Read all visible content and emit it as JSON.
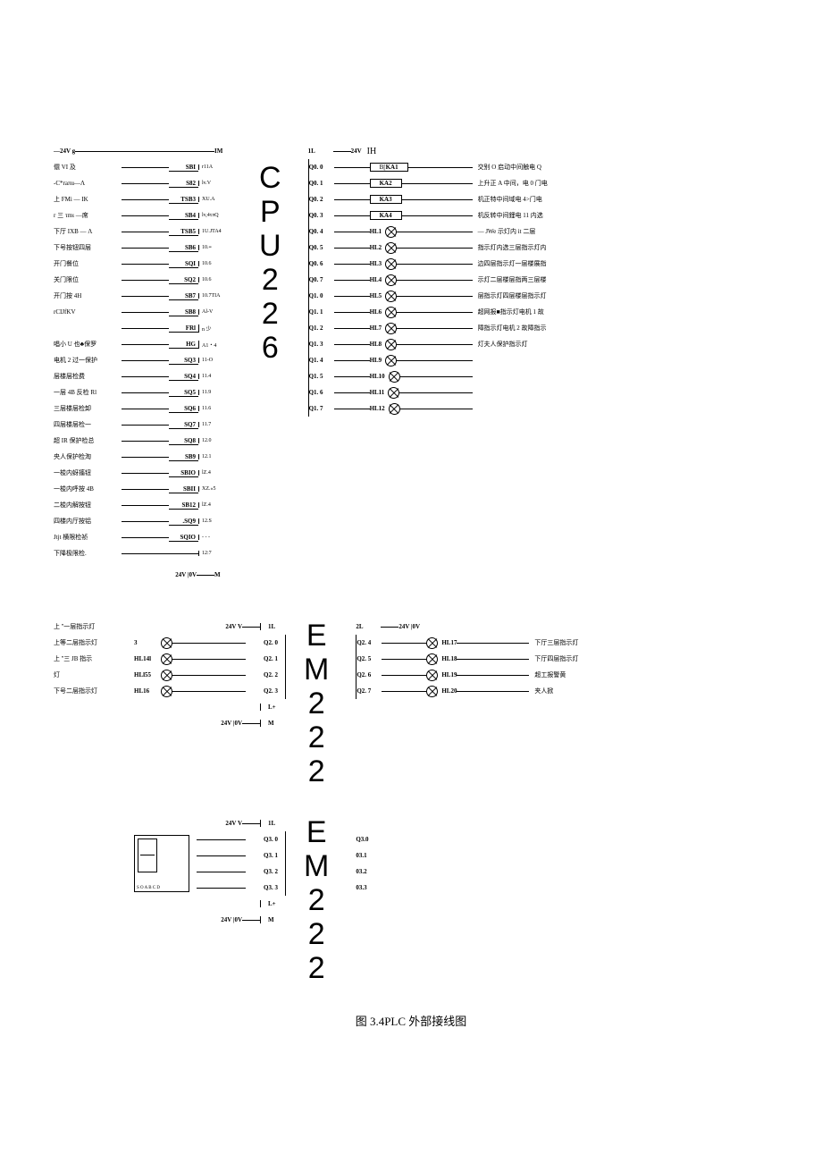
{
  "caption": "图 3.4PLC 外部接线图",
  "cpu": {
    "name": "CPU226",
    "power_top_left": "—24V  g",
    "power_top_right": "IM",
    "power_bottom": "24V  |0V",
    "left": [
      {
        "t": "儇 VI 及",
        "r": "SBI",
        "p": "r11A"
      },
      {
        "t": "-C*raπu—Λ",
        "r": "S82",
        "p": "lv.V"
      },
      {
        "t": "上 FMi — IK",
        "r": "TSB3",
        "p": "XU.A"
      },
      {
        "t": "r 三 τmι —席",
        "r": "SB4",
        "p": "lv,4τπQ"
      },
      {
        "t": "下厅 IXB — Λ",
        "r": "TSB5",
        "p": "1U.JTA4"
      },
      {
        "t": "下号按钮四层",
        "r": "SB6",
        "p": "10.≡"
      },
      {
        "t": "开门餐位",
        "r": "SQI",
        "p": "10.6"
      },
      {
        "t": "关门限位",
        "r": "SQ2",
        "p": "10.6"
      },
      {
        "t": "开门按 4H",
        "r": "SB7",
        "p": "10.7TIA"
      },
      {
        "t": "rCIJfKV",
        "r": "SB8",
        "p": "Al-V"
      },
      {
        "t": "",
        "r": "FRl",
        "p": "n 少"
      },
      {
        "t": "唱小 U 也♣保罗",
        "r": "HG",
        "p": "A1・4"
      },
      {
        "t": "电机 2 过一保护",
        "r": "SQ3",
        "p": "11-O"
      },
      {
        "t": "层楼层检费",
        "r": "SQ4",
        "p": "11.4"
      },
      {
        "t": "一层 4B 反检 Rl",
        "r": "SQ5",
        "p": "11.9"
      },
      {
        "t": "三层楼层检卸",
        "r": "SQ6",
        "p": "11.6"
      },
      {
        "t": "四层楼层检一",
        "r": "SQ7",
        "p": "11.7"
      },
      {
        "t": "超 IR 保护检总",
        "r": "SQ8",
        "p": "12.0"
      },
      {
        "t": "央人保护检淘",
        "r": "SB9",
        "p": "12.1"
      },
      {
        "t": "一梭内蚜搐钮",
        "r": "SBIO",
        "p": "lZ.4"
      },
      {
        "t": "一梭内呼按 4B",
        "r": "SBII",
        "p": "XZ.«5"
      },
      {
        "t": "二梭内解按钮",
        "r": "SB12",
        "p": "lZ.4"
      },
      {
        "t": "四楼内厅按铝",
        "r": ".SQ9",
        "p": "12.S"
      },
      {
        "t": "Jtjt 横限检祯",
        "r": "SQIO",
        "p": "- - -"
      },
      {
        "t": "下降极限检.",
        "r": "",
        "p": "12:7"
      }
    ],
    "outputs": [
      {
        "q": "Q0. 0",
        "r": "KA1",
        "pre": "B[",
        "t": "交别 O 启动中间触电 Q",
        "type": "relay"
      },
      {
        "q": "Q0. 1",
        "r": "KA2",
        "t": "上升正 A 中间，电 0 门电",
        "type": "relay"
      },
      {
        "q": "Q0. 2",
        "r": "KA3",
        "t": "机正特中间域电 4>门电",
        "type": "relay"
      },
      {
        "q": "Q0. 3",
        "r": "KA4",
        "t": "机反转中间鋰电 11 内选",
        "type": "relay"
      },
      {
        "q": "Q0. 4",
        "r": "HL1",
        "t": "— JWe 示灯内 it 二层",
        "type": "lamp"
      },
      {
        "q": "Q0. 5",
        "r": "HL2",
        "t": "指示灯内选三层指示灯内",
        "type": "lamp"
      },
      {
        "q": "Q0. 6",
        "r": "HL3",
        "t": "边四层指示灯一层楼展指",
        "type": "lamp"
      },
      {
        "q": "Q0. 7",
        "r": "HL4",
        "t": "示灯二层楼层指两三层楼",
        "type": "lamp"
      },
      {
        "q": "Q1. 0",
        "r": "HL5",
        "t": "层指示灯四层楼层指示灯",
        "type": "lamp"
      },
      {
        "q": "Q1. 1",
        "r": "HL6",
        "t": "超网报■指示灯电机 1 故",
        "type": "lamp"
      },
      {
        "q": "Q1. 2",
        "r": "HL7",
        "t": "障指示灯电机 2 故障指示",
        "type": "lamp"
      },
      {
        "q": "Q1. 3",
        "r": "HL8",
        "t": "灯夫人保护指示灯",
        "type": "lamp"
      },
      {
        "q": "Q1. 4",
        "r": "HL9",
        "t": "",
        "type": "lamp"
      },
      {
        "q": "Q1. 5",
        "r": "HL10",
        "t": "",
        "type": "lamp"
      },
      {
        "q": "Q1. 6",
        "r": "HL11",
        "t": "",
        "type": "lamp"
      },
      {
        "q": "Q1. 7",
        "r": "HL12",
        "t": "",
        "type": "lamp"
      }
    ],
    "out_header": {
      "l": "1L",
      "p": "24V",
      "ih": "IH"
    }
  },
  "em1": {
    "name": "EM222",
    "power": "24V   V",
    "power_bottom": "24V  |0V",
    "header": "1L",
    "left": [
      {
        "t": "上  ''一层指示灯",
        "r": "3",
        "q": "Q2. 0"
      },
      {
        "t": "上等二层指示灯",
        "r": "HL14l",
        "q": "Q2. 1"
      },
      {
        "t": "上  ''三 JB 指示",
        "r": "HLl55",
        "q": "Q2. 2"
      },
      {
        "t": "灯",
        "r": "HL16",
        "q": "Q2. 3"
      },
      {
        "t": "下号二层指示灯",
        "r": "",
        "q": ""
      }
    ],
    "lplus": "L+",
    "m": "M",
    "right_header": {
      "l": "2L",
      "p": "24V  |0V"
    },
    "right": [
      {
        "q": "Q2. 4",
        "r": "HL17",
        "t": "下厅三层指示灯"
      },
      {
        "q": "Q2. 5",
        "r": "HL18",
        "t": "下厅四层指示灯"
      },
      {
        "q": "Q2. 6",
        "r": "HL19",
        "t": "超工报警黄"
      },
      {
        "q": "Q2. 7",
        "r": "HL20",
        "t": "夹人掀"
      }
    ]
  },
  "em2": {
    "name": "EM222",
    "power": "24V   V",
    "power_bottom": "24V  |0V",
    "header": "1L",
    "left_q": [
      "Q3. 0",
      "Q3. 1",
      "Q3. 2",
      "Q3. 3"
    ],
    "lplus": "L+",
    "m": "M",
    "display_labels": "S O A  B  C  D",
    "right": [
      "Q3.0",
      "03.1",
      "03.2",
      "03.3"
    ]
  }
}
